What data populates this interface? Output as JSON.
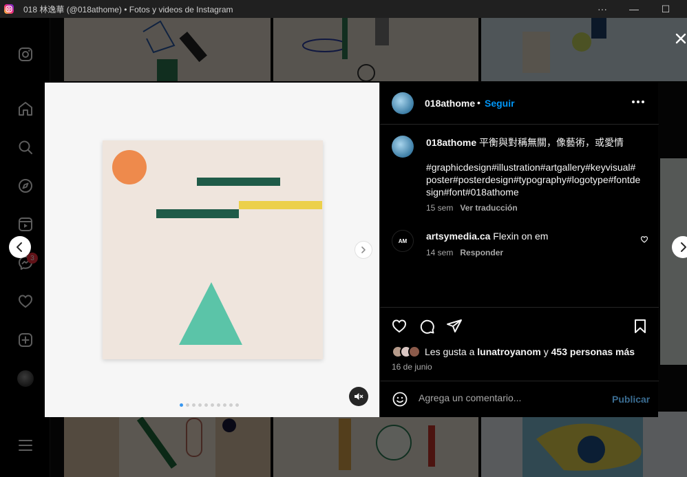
{
  "window": {
    "title": "018 林逸華 (@018athome) • Fotos y videos de Instagram",
    "more_label": "···",
    "minimize_label": "—",
    "maximize_label": "☐"
  },
  "sidebar": {
    "items": [
      {
        "icon": "instagram-icon"
      },
      {
        "icon": "home-icon"
      },
      {
        "icon": "search-icon"
      },
      {
        "icon": "explore-icon"
      },
      {
        "icon": "reels-icon"
      },
      {
        "icon": "messenger-icon"
      },
      {
        "icon": "heart-icon"
      },
      {
        "icon": "create-icon"
      },
      {
        "icon": "profile-avatar"
      },
      {
        "icon": "menu-icon"
      }
    ],
    "messages_badge": "3"
  },
  "post": {
    "author": "018athome",
    "separator": "•",
    "follow_label": "Seguir",
    "caption_author": "018athome",
    "caption_text": "平衡與對稱無關，像藝術，或愛情",
    "hashtags": "#graphicdesign#illustration#artgallery#keyvisual#poster#posterdesign#typography#logotype#fontdesign#font#018athome",
    "caption_time": "15 sem",
    "translate_label": "Ver traducción",
    "comments": [
      {
        "avatar_text": "AM",
        "author": "artsymedia.ca",
        "text": "Flexin on em",
        "time": "14 sem",
        "reply_label": "Responder"
      }
    ],
    "likes_prefix": "Les gusta a",
    "likes_user": "lunatroyanom",
    "likes_and": "y",
    "likes_count": "453 personas más",
    "date": "16 de junio",
    "comment_placeholder": "Agrega un comentario...",
    "publish_label": "Publicar",
    "carousel_count": 10,
    "carousel_active": 0
  },
  "colors": {
    "accent_blue": "#0095f6",
    "artwork_bg": "#efe5dd",
    "orange_circle": "#ee8a4c",
    "green_bar": "#1f5b48",
    "yellow_bar": "#ecd04a",
    "teal_triangle": "#5bc4a8"
  }
}
